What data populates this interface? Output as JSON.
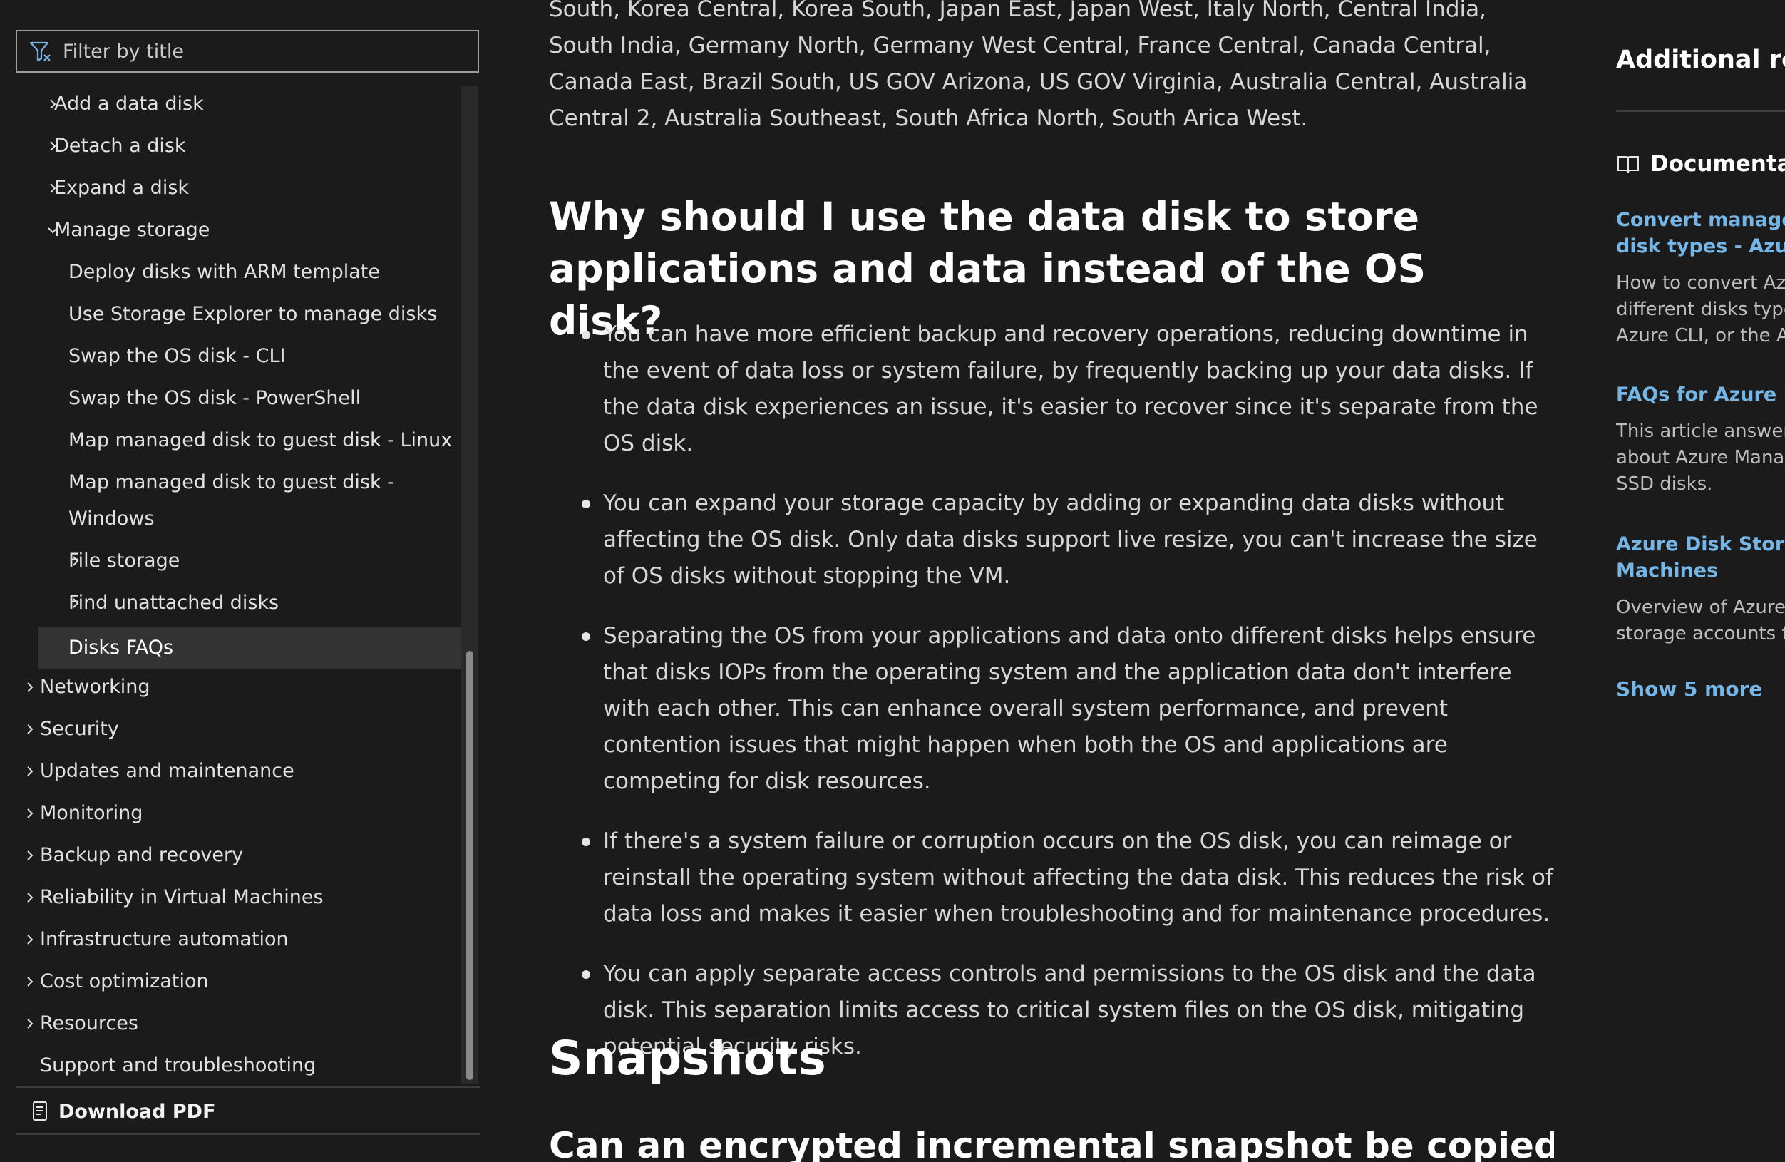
{
  "sidebar": {
    "filter_placeholder": "Filter by title",
    "filter_icon": "filter-icon",
    "items": [
      {
        "label": "Add a data disk",
        "expander": "collapsed",
        "level": 1
      },
      {
        "label": "Detach a disk",
        "expander": "collapsed",
        "level": 1
      },
      {
        "label": "Expand a disk",
        "expander": "collapsed",
        "level": 1
      },
      {
        "label": "Manage storage",
        "expander": "expanded",
        "level": 1
      },
      {
        "label": "Deploy disks with ARM template",
        "expander": "none",
        "level": 2
      },
      {
        "label": "Use Storage Explorer to manage disks",
        "expander": "none",
        "level": 2
      },
      {
        "label": "Swap the OS disk - CLI",
        "expander": "none",
        "level": 2
      },
      {
        "label": "Swap the OS disk - PowerShell",
        "expander": "none",
        "level": 2
      },
      {
        "label": "Map managed disk to guest disk - Linux",
        "expander": "none",
        "level": 2
      },
      {
        "label": "Map managed disk to guest disk -",
        "expander": "none",
        "level": 2
      },
      {
        "label": "Windows",
        "expander": "none",
        "level": 2
      },
      {
        "label": "File storage",
        "expander": "collapsed",
        "level": 2
      },
      {
        "label": "Find unattached disks",
        "expander": "collapsed",
        "level": 2
      },
      {
        "label": "Disks FAQs",
        "expander": "none",
        "level": 2,
        "selected": true
      },
      {
        "label": "Networking",
        "expander": "collapsed",
        "level": 0
      },
      {
        "label": "Security",
        "expander": "collapsed",
        "level": 0
      },
      {
        "label": "Updates and maintenance",
        "expander": "collapsed",
        "level": 0
      },
      {
        "label": "Monitoring",
        "expander": "collapsed",
        "level": 0
      },
      {
        "label": "Backup and recovery",
        "expander": "collapsed",
        "level": 0
      },
      {
        "label": "Reliability in Virtual Machines",
        "expander": "collapsed",
        "level": 0
      },
      {
        "label": "Infrastructure automation",
        "expander": "collapsed",
        "level": 0
      },
      {
        "label": "Cost optimization",
        "expander": "collapsed",
        "level": 0
      },
      {
        "label": "Resources",
        "expander": "collapsed",
        "level": 0
      },
      {
        "label": "Support and troubleshooting",
        "expander": "none",
        "level": 0
      }
    ],
    "download_pdf": "Download PDF"
  },
  "main": {
    "region_paragraph": "South, Korea Central, Korea South, Japan East, Japan West, Italy North, Central India, South India, Germany North, Germany West Central, France Central, Canada Central, Canada East, Brazil South, US GOV Arizona, US GOV Virginia, Australia Central, Australia Central 2, Australia Southeast, South Africa North, South Arica West.",
    "heading_why": "Why should I use the data disk to store applications and data instead of the OS disk?",
    "bullets": [
      "You can have more efficient backup and recovery operations, reducing downtime in the event of data loss or system failure, by frequently backing up your data disks. If the data disk experiences an issue, it's easier to recover since it's separate from the OS disk.",
      "You can expand your storage capacity by adding or expanding data disks without affecting the OS disk. Only data disks support live resize, you can't increase the size of OS disks without stopping the VM.",
      "Separating the OS from your applications and data onto different disks helps ensure that disks IOPs from the operating system and the application data don't interfere with each other. This can enhance overall system performance, and prevent contention issues that might happen when both the OS and applications are competing for disk resources.",
      "If there's a system failure or corruption occurs on the OS disk, you can reimage or reinstall the operating system without affecting the data disk. This reduces the risk of data loss and makes it easier when troubleshooting and for maintenance procedures.",
      "You can apply separate access controls and permissions to the OS disk and the data disk. This separation limits access to critical system files on the OS disk, mitigating potential security risks."
    ],
    "heading_snapshots": "Snapshots",
    "heading_encrypted": "Can an encrypted incremental snapshot be copied"
  },
  "right_rail": {
    "title": "Additional reso",
    "documentation_label": "Documentati",
    "links": [
      {
        "title_lines": [
          "Convert managed",
          "disk types - Azure"
        ],
        "desc_lines": [
          "How to convert Azu",
          "different disks type",
          "Azure CLI, or the Az"
        ]
      },
      {
        "title_lines": [
          "FAQs for Azure Dis"
        ],
        "desc_lines": [
          "This article answers",
          "about Azure Manag",
          "SSD disks."
        ]
      },
      {
        "title_lines": [
          "Azure Disk Storage",
          "Machines"
        ],
        "desc_lines": [
          "Overview of Azure ",
          "storage accounts fo"
        ]
      }
    ],
    "show_more": "Show 5 more"
  },
  "colors": {
    "background": "#1b1b1b",
    "link": "#75b6e7",
    "selected_item_bg": "#333333",
    "text": "#d6d6d6",
    "heading": "#ffffff"
  }
}
